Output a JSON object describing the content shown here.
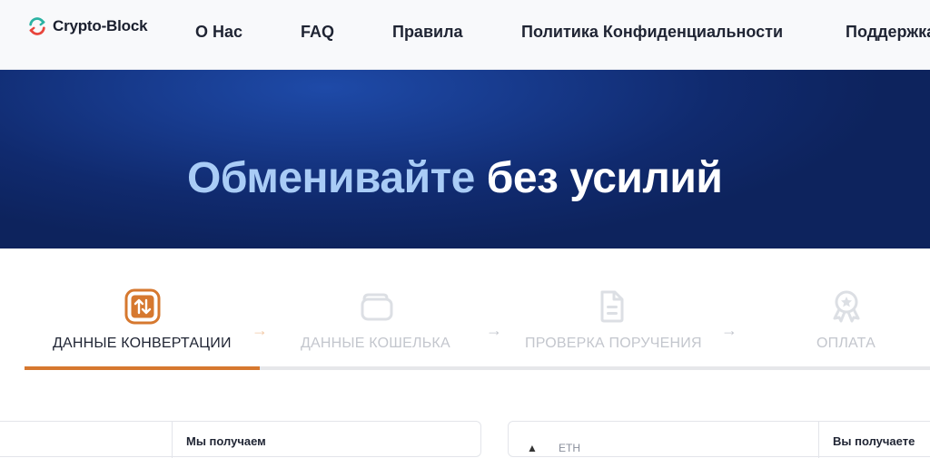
{
  "header": {
    "logo_text": "Crypto-Block",
    "nav": [
      {
        "label": "О Нас"
      },
      {
        "label": "FAQ"
      },
      {
        "label": "Правила"
      },
      {
        "label": "Политика Конфиденциальности"
      },
      {
        "label": "Поддержка"
      }
    ]
  },
  "hero": {
    "title_highlight": "Обменивайте",
    "title_rest": "без усилий"
  },
  "steps": [
    {
      "label": "ДАННЫЕ КОНВЕРТАЦИИ",
      "icon": "swap-arrows-icon",
      "active": true
    },
    {
      "label": "ДАННЫЕ КОШЕЛЬКА",
      "icon": "wallet-icon",
      "active": false
    },
    {
      "label": "ПРОВЕРКА ПОРУЧЕНИЯ",
      "icon": "document-icon",
      "active": false
    },
    {
      "label": "ОПЛАТА",
      "icon": "badge-icon",
      "active": false
    }
  ],
  "progress": {
    "completed_steps": 1,
    "total_steps": 4
  },
  "exchange": {
    "left_card": {
      "receive_label": "Мы получаем"
    },
    "right_card": {
      "coin": "ETH",
      "receive_label": "Вы получаете"
    }
  },
  "colors": {
    "accent": "#d6782f",
    "hero_dark": "#0d235d",
    "hero_light": "#1e4aa8",
    "hero_highlight_text": "#a9ccf6"
  }
}
